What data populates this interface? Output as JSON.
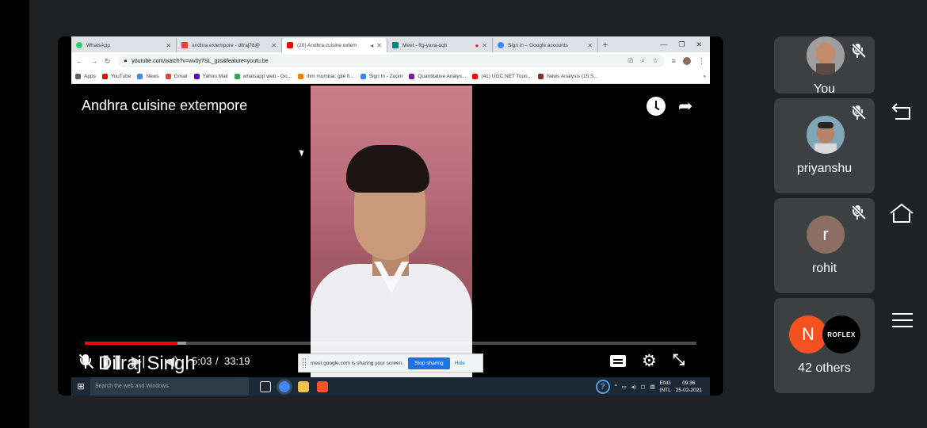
{
  "browser": {
    "tabs": [
      {
        "label": "WhatsApp",
        "color": "#25d366"
      },
      {
        "label": "andhra extempore - dilraj78@",
        "color": "#ea4335"
      },
      {
        "label": "(20) Andhra cuisine extem",
        "color": "#ff0000"
      },
      {
        "label": "Meet - ftg-yava-oqh",
        "color": "#00897b"
      },
      {
        "label": "Sign in – Google accounts",
        "color": "#4285f4"
      }
    ],
    "url": "youtube.com/watch?v=wv0y7SL_gzs&feature=youtu.be",
    "bookmarks": [
      "Apps",
      "YouTube",
      "News",
      "Gmail",
      "Yahoo Mail",
      "whatsapp web - Go...",
      "ihm mumbai: gile fi...",
      "Sign In - Zoom",
      "Quantitative Analys...",
      "(41) UGC NET Touri...",
      "News Analysis (15 S..."
    ]
  },
  "video": {
    "title": "Andhra cuisine extempore",
    "time_current": "5:03",
    "time_separator": "/",
    "time_total": "33:19",
    "progress_fraction": 0.152
  },
  "presenter": {
    "name": "Dilraj Singh"
  },
  "share_banner": {
    "message": "meet.google.com is sharing your screen.",
    "stop_label": "Stop sharing",
    "hide_label": "Hide"
  },
  "taskbar": {
    "search_placeholder": "Search the web and Windows",
    "lang_top": "ENG",
    "lang_bottom": "INTL",
    "time": "09:36",
    "date": "25-02-2021"
  },
  "participants": [
    {
      "label": "You",
      "avatar_initial": "",
      "avatar_color": "#b5866a"
    },
    {
      "label": "priyanshu",
      "avatar_initial": "",
      "avatar_color": "#6a8fa5"
    },
    {
      "label": "rohit",
      "avatar_initial": "r",
      "avatar_color": "#8d6e63"
    }
  ],
  "others": {
    "label": "42 others",
    "avatar_initial": "N",
    "avatar_color": "#f4511e",
    "second_avatar_text": "ROFLEX"
  }
}
